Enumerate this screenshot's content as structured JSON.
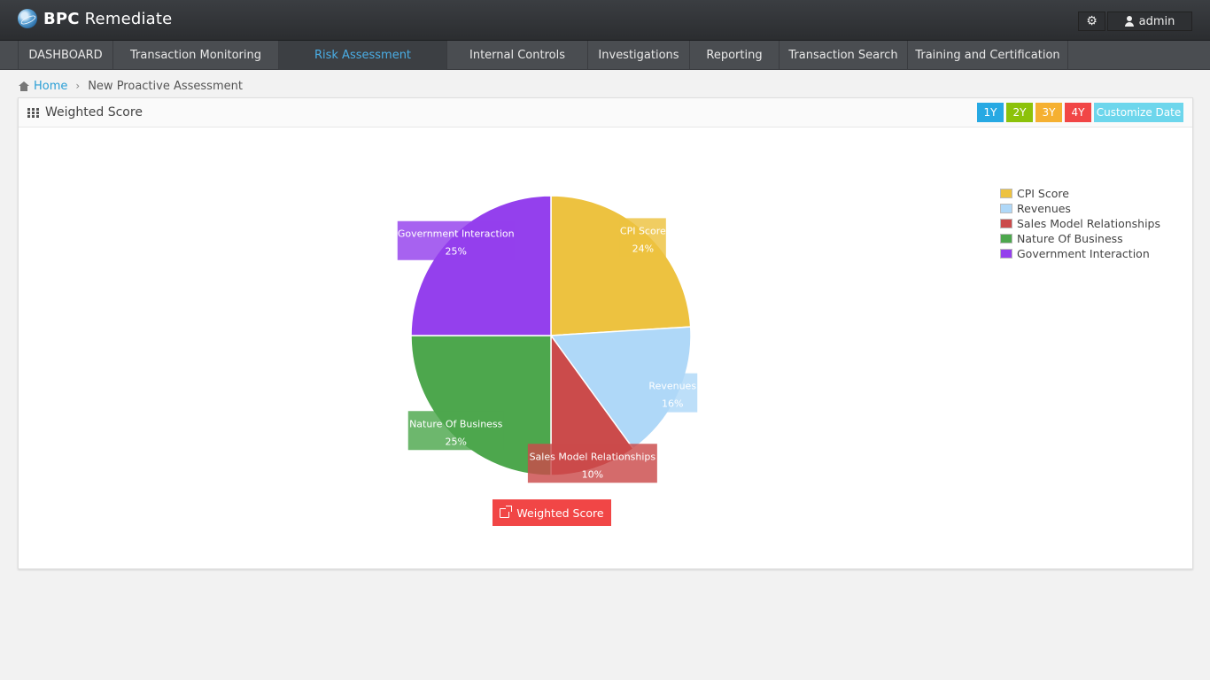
{
  "app": {
    "title_bold": "BPC",
    "title_rest": " Remediate"
  },
  "header": {
    "user_label": "admin"
  },
  "nav": {
    "items": [
      {
        "label": "DASHBOARD"
      },
      {
        "label": "Transaction Monitoring"
      },
      {
        "label": "Risk Assessment"
      },
      {
        "label": "Internal Controls"
      },
      {
        "label": "Investigations"
      },
      {
        "label": "Reporting"
      },
      {
        "label": "Transaction Search"
      },
      {
        "label": "Training and Certification"
      }
    ],
    "active_index": 2
  },
  "breadcrumb": {
    "home": "Home",
    "current": "New Proactive Assessment"
  },
  "panel": {
    "title": "Weighted Score",
    "range_buttons": [
      {
        "label": "1Y",
        "color": "#27a9e3"
      },
      {
        "label": "2Y",
        "color": "#8cc20a"
      },
      {
        "label": "3Y",
        "color": "#f5b031"
      },
      {
        "label": "4Y",
        "color": "#f14646"
      },
      {
        "label": "Customize Date",
        "color": "#6dd6ec"
      }
    ],
    "weighted_score_button": "Weighted Score"
  },
  "chart_data": {
    "type": "pie",
    "slices": [
      {
        "label": "CPI Score",
        "value": 24,
        "display": "24%",
        "color": "#edc240"
      },
      {
        "label": "Revenues",
        "value": 16,
        "display": "16%",
        "color": "#afd8f8"
      },
      {
        "label": "Sales Model Relationships",
        "value": 10,
        "display": "10%",
        "color": "#cb4b4b"
      },
      {
        "label": "Nature Of Business",
        "value": 25,
        "display": "25%",
        "color": "#4da74d"
      },
      {
        "label": "Government Interaction",
        "value": 25,
        "display": "25%",
        "color": "#9440ed"
      }
    ],
    "legend_position": "top-right"
  }
}
